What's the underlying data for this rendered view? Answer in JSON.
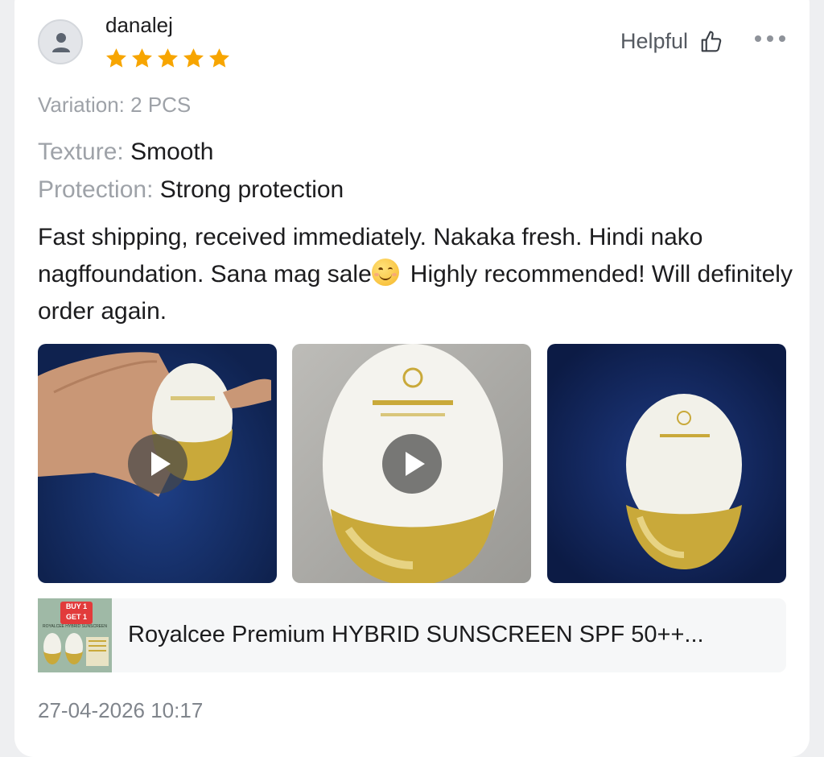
{
  "review": {
    "username": "danalej",
    "rating": 5,
    "helpful_label": "Helpful",
    "variation": "Variation: 2 PCS",
    "attributes": [
      {
        "key": "Texture:",
        "value": "Smooth"
      },
      {
        "key": "Protection:",
        "value": "Strong protection"
      }
    ],
    "text_before_emoji": "Fast shipping, received immediately. Nakaka fresh. Hindi nako nagffoundation. Sana mag sale",
    "text_after_emoji": "Highly recommended! Will definitely order again.",
    "media": [
      {
        "type": "video",
        "subject": "hand holding sunscreen bottle"
      },
      {
        "type": "video",
        "subject": "sunscreen bottle closeup"
      },
      {
        "type": "image",
        "subject": "sunscreen bottle on fabric"
      }
    ],
    "product": {
      "thumb_badge": "BUY 1 GET 1",
      "thumb_label": "ROYALCEE HYBRID SUNSCREEN",
      "title": "Royalcee Premium HYBRID SUNSCREEN  SPF 50++..."
    },
    "date": "27-04-2026 10:17"
  },
  "colors": {
    "star": "#f7a500",
    "bottle_gold": "#c9a93a",
    "muted_text": "#9ea2a8"
  },
  "icons": [
    "user-icon",
    "star-icon",
    "thumbs-up-icon",
    "more-icon",
    "play-icon"
  ]
}
